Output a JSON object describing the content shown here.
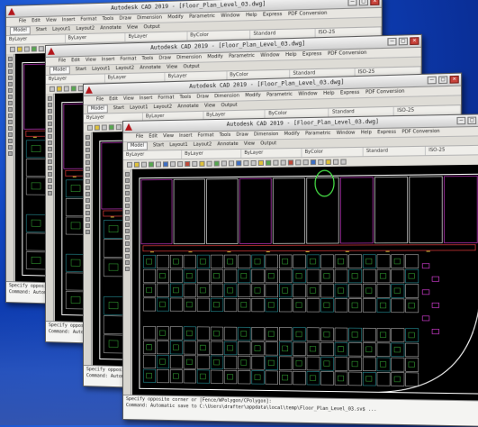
{
  "app": {
    "title": "Autodesk CAD 2019 - [Floor_Plan_Level_03.dwg]",
    "menu": [
      "File",
      "Edit",
      "View",
      "Insert",
      "Format",
      "Tools",
      "Draw",
      "Dimension",
      "Modify",
      "Parametric",
      "Window",
      "Help",
      "Express",
      "PDF Conversion"
    ],
    "ribbon_tabs": [
      "Model",
      "Start",
      "Layout1",
      "Layout2",
      "Annotate",
      "View",
      "Output"
    ],
    "active_tab": "Model",
    "properties": [
      "ByLayer",
      "ByLayer",
      "ByLayer",
      "ByColor",
      "Standard",
      "ISO-25"
    ],
    "command_lines": [
      "Specify opposite corner or [Fence/WPolygon/CPolygon]:",
      "Command: Automatic save to C:\\Users\\drafter\\appdata\\local\\temp\\Floor_Plan_Level_03.sv$ ..."
    ],
    "window_controls": {
      "minimize": "–",
      "maximize": "□",
      "close": "×"
    }
  },
  "colors": {
    "desktop_blue": "#1046c4",
    "canvas_background": "#000000",
    "walls": "#ffffff",
    "rooms_magenta": "#e040e0",
    "furniture_green": "#46e046",
    "outline_red": "#e03b3b",
    "annotation_yellow": "#e8e040",
    "fixtures_cyan": "#39d6e0"
  },
  "stack": {
    "window_count": 4,
    "style": "cascaded perspective"
  }
}
